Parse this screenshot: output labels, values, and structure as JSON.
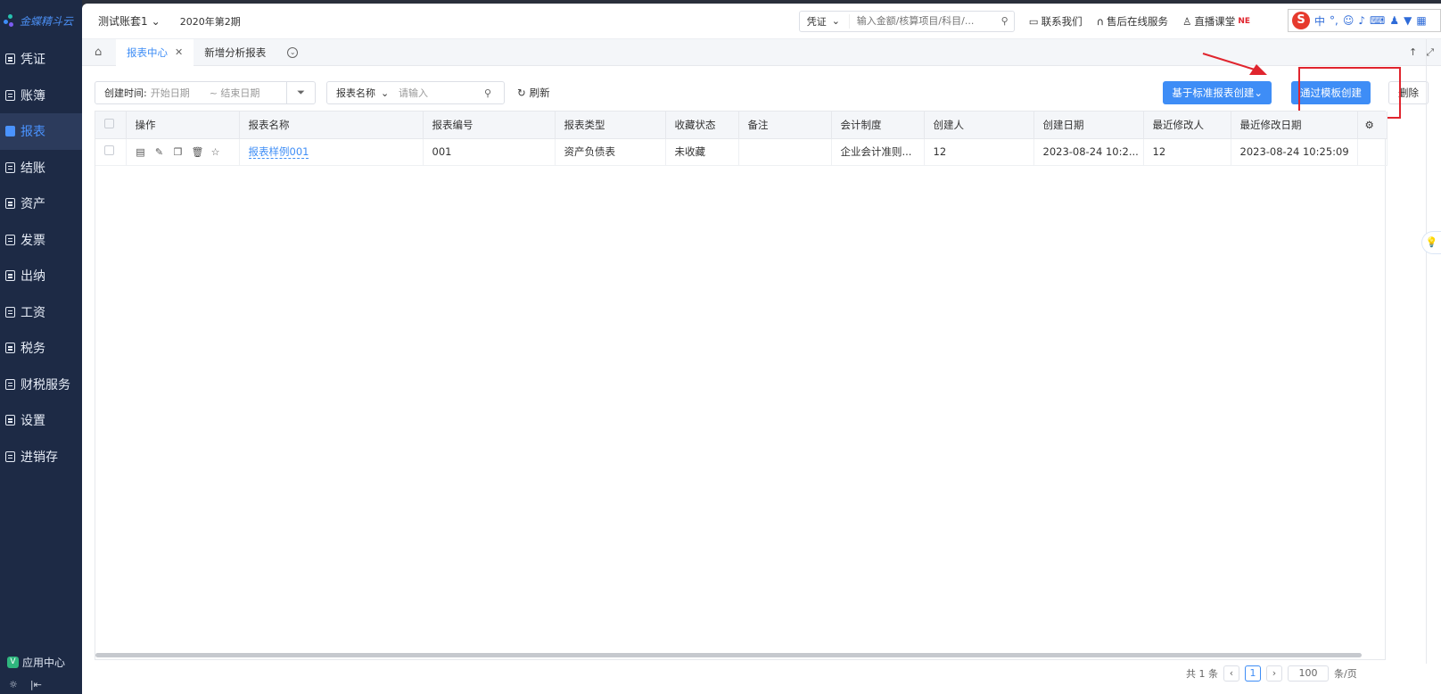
{
  "app": {
    "logo_text": "金蝶精斗云"
  },
  "sidebar": {
    "items": [
      {
        "label": "凭证",
        "icon": "voucher-icon"
      },
      {
        "label": "账簿",
        "icon": "ledger-icon"
      },
      {
        "label": "报表",
        "icon": "report-icon",
        "active": true
      },
      {
        "label": "结账",
        "icon": "closing-icon"
      },
      {
        "label": "资产",
        "icon": "asset-icon"
      },
      {
        "label": "发票",
        "icon": "invoice-icon"
      },
      {
        "label": "出纳",
        "icon": "cashier-icon"
      },
      {
        "label": "工资",
        "icon": "salary-icon"
      },
      {
        "label": "税务",
        "icon": "tax-icon"
      },
      {
        "label": "财税服务",
        "icon": "service-icon"
      },
      {
        "label": "设置",
        "icon": "settings-icon"
      },
      {
        "label": "进销存",
        "icon": "inventory-icon"
      }
    ],
    "app_center": "应用中心",
    "app_center_badge": "V"
  },
  "topbar": {
    "account": "测试账套1",
    "period": "2020年第2期",
    "search_select": "凭证",
    "search_placeholder": "输入金额/核算项目/科目/...",
    "contact": "联系我们",
    "after_sales": "售后在线服务",
    "live_class": "直播课堂",
    "live_badge": "NE"
  },
  "ime": {
    "logo": "S",
    "mode": "中",
    "punct": "°,"
  },
  "tabs": {
    "items": [
      {
        "label": "报表中心",
        "active": true
      },
      {
        "label": "新增分析报表",
        "active": false
      }
    ]
  },
  "toolbar": {
    "date_label": "创建时间:",
    "start_placeholder": "开始日期",
    "end_placeholder": "~ 结束日期",
    "name_select": "报表名称",
    "name_placeholder": "请输入",
    "refresh": "刷新",
    "create_standard": "基于标准报表创建",
    "create_template": "通过模板创建",
    "delete": "删除"
  },
  "table": {
    "columns": [
      "操作",
      "报表名称",
      "报表编号",
      "报表类型",
      "收藏状态",
      "备注",
      "会计制度",
      "创建人",
      "创建日期",
      "最近修改人",
      "最近修改日期"
    ],
    "rows": [
      {
        "name": "报表样例001",
        "code": "001",
        "type": "资产负债表",
        "fav": "未收藏",
        "note": "",
        "system": "企业会计准则...",
        "creator": "12",
        "created": "2023-08-24 10:2...",
        "modifier": "12",
        "modified": "2023-08-24 10:25:09"
      }
    ]
  },
  "pager": {
    "total": "共 1 条",
    "page": "1",
    "size": "100",
    "unit": "条/页"
  },
  "colors": {
    "accent": "#3e8df6",
    "sidebar_bg": "#1d2a45",
    "highlight": "#e0252e"
  }
}
